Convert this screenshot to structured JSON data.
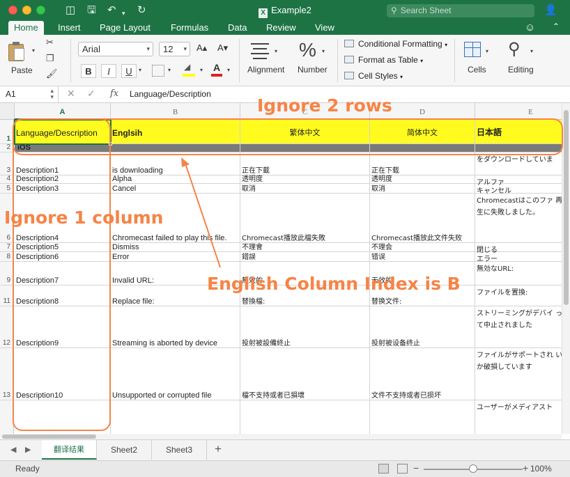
{
  "window": {
    "title": "Example2",
    "search_placeholder": "Search Sheet"
  },
  "ribbon": {
    "tabs": [
      "Home",
      "Insert",
      "Page Layout",
      "Formulas",
      "Data",
      "Review",
      "View"
    ],
    "active_tab": "Home",
    "paste_label": "Paste",
    "font_name": "Arial",
    "font_size": "12",
    "bold": "B",
    "italic": "I",
    "underline": "U",
    "grow_font": "A▴",
    "shrink_font": "A▾",
    "font_color_letter": "A",
    "alignment_label": "Alignment",
    "number_label": "Number",
    "number_icon": "%",
    "conditional_formatting": "Conditional Formatting",
    "format_as_table": "Format as Table",
    "cell_styles": "Cell Styles",
    "cells_label": "Cells",
    "editing_label": "Editing",
    "accent": "#1e7345"
  },
  "formula_bar": {
    "name_box": "A1",
    "fx": "fx",
    "content": "Language/Description"
  },
  "grid": {
    "columns": [
      "A",
      "B",
      "C",
      "D",
      "E"
    ],
    "header_row": [
      "Language/Description",
      "Englsih",
      "繁体中文",
      "简体中文",
      "日本語"
    ],
    "ios_label": "iOS",
    "rows": [
      {
        "num": "3",
        "a": "Description1",
        "b": "is downloading",
        "c": "正在下載",
        "d": "正在下载",
        "e": "をダウンロードしていま"
      },
      {
        "num": "4",
        "a": "Description2",
        "b": "Alpha",
        "c": "透明度",
        "d": "透明度",
        "e": "アルファ"
      },
      {
        "num": "5",
        "a": "Description3",
        "b": "Cancel",
        "c": "取消",
        "d": "取消",
        "e": "キャンセル"
      },
      {
        "num": "6",
        "a": "Description4",
        "b": "Chromecast failed to play this file.",
        "c": "Chromecast播放此檔失敗",
        "d": "Chromecast播放此文件失败",
        "e": "Chromecastはこのファ 再生に失敗しました。"
      },
      {
        "num": "7",
        "a": "Description5",
        "b": "Dismiss",
        "c": "不理會",
        "d": "不理会",
        "e": "閉じる"
      },
      {
        "num": "8",
        "a": "Description6",
        "b": "Error",
        "c": "錯誤",
        "d": "错误",
        "e": "エラー"
      },
      {
        "num": "9",
        "a": "Description7",
        "b": "Invalid URL:",
        "c": "無效的",
        "d": "无效的",
        "e": "無効なURL:"
      },
      {
        "num": "11",
        "a": "Description8",
        "b": "Replace file:",
        "c": "替換檔:",
        "d": "替换文件:",
        "e": "ファイルを置換:"
      },
      {
        "num": "12",
        "a": "Description9",
        "b": "Streaming is aborted by device",
        "c": "投射被設備終止",
        "d": "投射被设备终止",
        "e": "ストリーミングがデバイ って中止されました"
      },
      {
        "num": "13",
        "a": "Description10",
        "b": "Unsupported or corrupted file",
        "c": "檔不支持或者已損壞",
        "d": "文件不支持或者已损坏",
        "e": "ファイルがサポートされ いか破損しています"
      },
      {
        "num": "",
        "a": "",
        "b": "",
        "c": "",
        "d": "",
        "e": "ユーザーがメディアスト"
      }
    ],
    "header_row_num": "1",
    "ios_row_num": "2",
    "highlight_color": "#fffb1f",
    "ios_fill": "#7a7a7a"
  },
  "annotations": {
    "ignore_rows": "Ignore 2 rows",
    "ignore_column": "Ignore 1 column",
    "english_index": "English Column Index is B",
    "color": "#f58446"
  },
  "sheets": {
    "tabs": [
      "翻译结果",
      "Sheet2",
      "Sheet3"
    ],
    "active": "翻译结果",
    "add": "+"
  },
  "status": {
    "ready": "Ready",
    "zoom": "100%"
  }
}
